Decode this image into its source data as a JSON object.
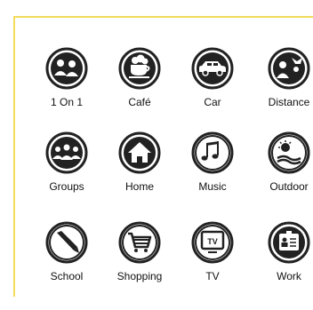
{
  "colors": {
    "border": "#f2dc5a",
    "icon_dark": "#222222",
    "label": "#111111"
  },
  "categories": [
    {
      "label": "1 On 1",
      "icon": "two-people-icon"
    },
    {
      "label": "Café",
      "icon": "coffee-cup-icon"
    },
    {
      "label": "Car",
      "icon": "car-icon"
    },
    {
      "label": "Distance",
      "icon": "long-distance-icon"
    },
    {
      "label": "Groups",
      "icon": "group-icon"
    },
    {
      "label": "Home",
      "icon": "house-icon"
    },
    {
      "label": "Music",
      "icon": "music-notes-icon"
    },
    {
      "label": "Outdoor",
      "icon": "outdoor-icon"
    },
    {
      "label": "School",
      "icon": "pencil-icon"
    },
    {
      "label": "Shopping",
      "icon": "shopping-cart-icon"
    },
    {
      "label": "TV",
      "icon": "television-icon"
    },
    {
      "label": "Work",
      "icon": "id-badge-icon"
    }
  ]
}
